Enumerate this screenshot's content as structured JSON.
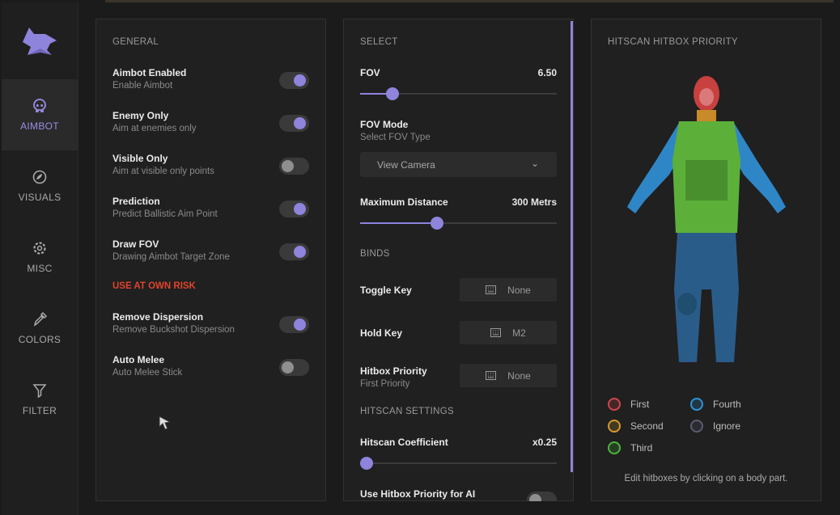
{
  "colors": {
    "accent": "#8e84dc",
    "risk": "#e0442c",
    "first": "#d2444c",
    "second": "#d49a2e",
    "third": "#4db43c",
    "fourth": "#2e94d8",
    "ignore": "#5a5a72"
  },
  "sidebar": {
    "items": [
      {
        "label": "AIMBOT",
        "icon": "skull-icon",
        "active": true
      },
      {
        "label": "VISUALS",
        "icon": "eye-icon"
      },
      {
        "label": "MISC",
        "icon": "gear-icon"
      },
      {
        "label": "COLORS",
        "icon": "eyedropper-icon"
      },
      {
        "label": "FILTER",
        "icon": "filter-icon"
      }
    ]
  },
  "general": {
    "title": "GENERAL",
    "risk_label": "USE AT OWN RISK",
    "items": [
      {
        "title": "Aimbot Enabled",
        "sub": "Enable Aimbot",
        "on": true
      },
      {
        "title": "Enemy Only",
        "sub": "Aim at enemies only",
        "on": true
      },
      {
        "title": "Visible Only",
        "sub": "Aim at visible only points",
        "on": false
      },
      {
        "title": "Prediction",
        "sub": "Predict Ballistic Aim Point",
        "on": true
      },
      {
        "title": "Draw FOV",
        "sub": "Drawing Aimbot Target Zone",
        "on": true
      },
      {
        "title": "Remove Dispersion",
        "sub": "Remove Buckshot Dispersion",
        "on": true
      },
      {
        "title": "Auto Melee",
        "sub": "Auto Melee Stick",
        "on": false
      }
    ]
  },
  "select": {
    "title": "SELECT",
    "fov": {
      "label": "FOV",
      "value": "6.50",
      "fraction": 0.13
    },
    "fov_mode": {
      "label": "FOV Mode",
      "sub": "Select FOV Type",
      "selected": "View Camera"
    },
    "max_distance": {
      "label": "Maximum Distance",
      "value": "300 Metrs",
      "fraction": 0.36
    },
    "binds_title": "BINDS",
    "binds": [
      {
        "label": "Toggle Key",
        "sub": "",
        "value": "None"
      },
      {
        "label": "Hold Key",
        "sub": "",
        "value": "M2"
      },
      {
        "label": "Hitbox Priority",
        "sub": "First Priority",
        "value": "None"
      }
    ],
    "hitscan_title": "HITSCAN SETTINGS",
    "hitscan_coef": {
      "label": "Hitscan Coefficient",
      "value": "x0.25",
      "fraction": 0.0
    },
    "use_hitbox_ai": {
      "label": "Use Hitbox Priority for AI",
      "on": false
    }
  },
  "hitbox": {
    "title": "HITSCAN HITBOX PRIORITY",
    "legend": [
      {
        "label": "First",
        "color": "#d2444c"
      },
      {
        "label": "Fourth",
        "color": "#2e94d8"
      },
      {
        "label": "Second",
        "color": "#d49a2e"
      },
      {
        "label": "Ignore",
        "color": "#5a5a72"
      },
      {
        "label": "Third",
        "color": "#4db43c"
      }
    ],
    "hint": "Edit hitboxes by clicking on a body part."
  }
}
